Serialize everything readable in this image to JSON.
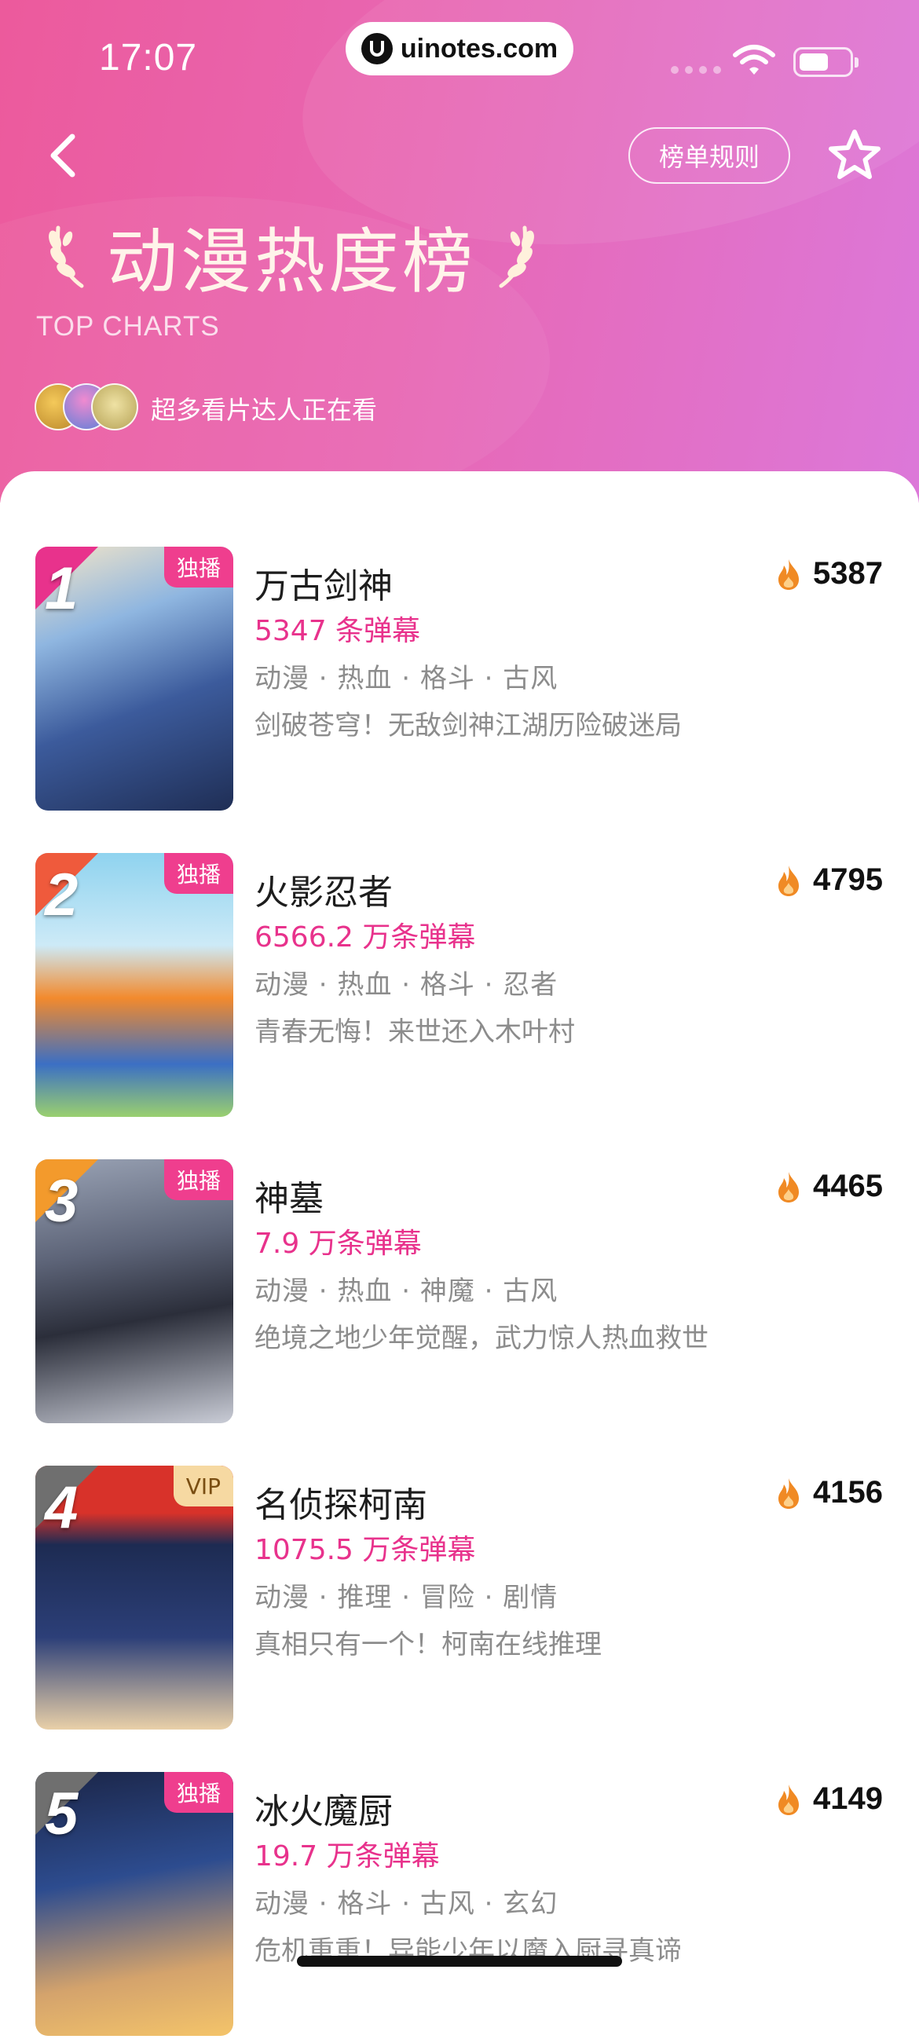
{
  "status_bar": {
    "time": "17:07",
    "url": "uinotes.com"
  },
  "header": {
    "rules_button": "榜单规则",
    "title": "动漫热度榜",
    "subtitle": "TOP CHARTS",
    "watching_text": "超多看片达人正在看"
  },
  "colors": {
    "accent": "#e8328c",
    "header_gradient_start": "#ec5a9c",
    "header_gradient_end": "#dc78d9"
  },
  "items": [
    {
      "rank": "1",
      "badge": "独播",
      "title": "万古剑神",
      "danmaku": "5347 条弹幕",
      "tags": "动漫 · 热血 · 格斗 · 古风",
      "desc": "剑破苍穹！无敌剑神江湖历险破迷局",
      "heat": "5387"
    },
    {
      "rank": "2",
      "badge": "独播",
      "title": "火影忍者",
      "danmaku": "6566.2 万条弹幕",
      "tags": "动漫 · 热血 · 格斗 · 忍者",
      "desc": "青春无悔！来世还入木叶村",
      "heat": "4795"
    },
    {
      "rank": "3",
      "badge": "独播",
      "title": "神墓",
      "danmaku": "7.9 万条弹幕",
      "tags": "动漫 · 热血 · 神魔 · 古风",
      "desc": "绝境之地少年觉醒，武力惊人热血救世",
      "heat": "4465"
    },
    {
      "rank": "4",
      "badge": "VIP",
      "title": "名侦探柯南",
      "danmaku": "1075.5 万条弹幕",
      "tags": "动漫 · 推理 · 冒险 · 剧情",
      "desc": "真相只有一个！柯南在线推理",
      "heat": "4156"
    },
    {
      "rank": "5",
      "badge": "独播",
      "title": "冰火魔厨",
      "danmaku": "19.7 万条弹幕",
      "tags": "动漫 · 格斗 · 古风 · 玄幻",
      "desc": "危机重重！异能少年以魔入厨寻真谛",
      "heat": "4149"
    }
  ]
}
